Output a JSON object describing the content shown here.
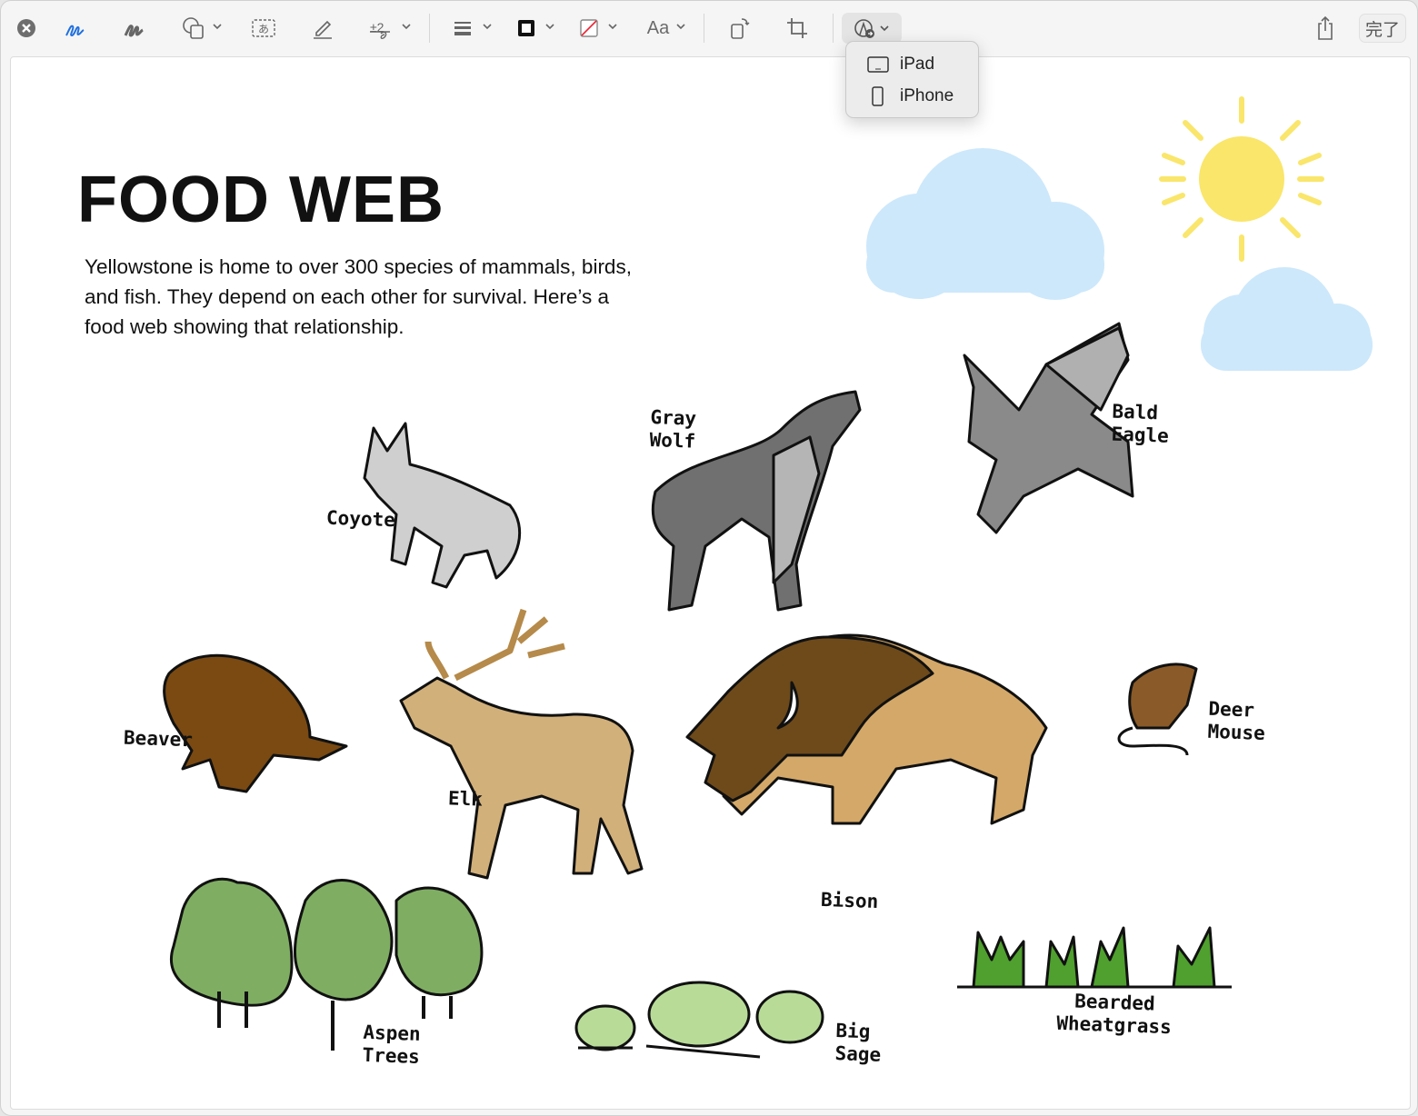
{
  "toolbar": {
    "icons": [
      "close-icon",
      "pen-icon",
      "sketch-icon",
      "shapes-icon",
      "text-box-icon",
      "signature-icon",
      "description-icon",
      "line-style-icon",
      "border-color-icon",
      "fill-color-icon",
      "text-style-icon",
      "rotate-icon",
      "crop-icon",
      "annotate-with-device-icon",
      "share-icon"
    ],
    "text_style_label": "Aa",
    "done_label": "完了",
    "accent": "#1f6fe0"
  },
  "device_menu": {
    "items": [
      {
        "label": "iPad",
        "icon": "ipad-icon"
      },
      {
        "label": "iPhone",
        "icon": "iphone-icon"
      }
    ]
  },
  "document": {
    "title": "FOOD WEB",
    "description": "Yellowstone is home to over 300 species of mammals, birds, and fish. They depend on each other for survival. Here’s a food web showing that relationship.",
    "labels": {
      "coyote": "Coyote",
      "gray_wolf": "Gray Wolf",
      "bald_eagle": "Bald Eagle",
      "beaver": "Beaver",
      "elk": "Elk",
      "bison": "Bison",
      "deer_mouse": "Deer Mouse",
      "aspen_trees": "Aspen Trees",
      "big_sage": "Big Sage",
      "bearded_wheatgrass": "Bearded Wheatgrass"
    },
    "colors": {
      "sun": "#f9e66b",
      "cloud": "#cde8fb",
      "wolf": "#707070",
      "coyote": "#cfcfcf",
      "eagle": "#8a8a8a",
      "beaver": "#7a4a12",
      "elk": "#d2b07a",
      "bison_dark": "#6e4a1a",
      "bison_light": "#d4a868",
      "tree": "#7fae63",
      "sage": "#b8dc98",
      "grass": "#4fa02e"
    }
  }
}
